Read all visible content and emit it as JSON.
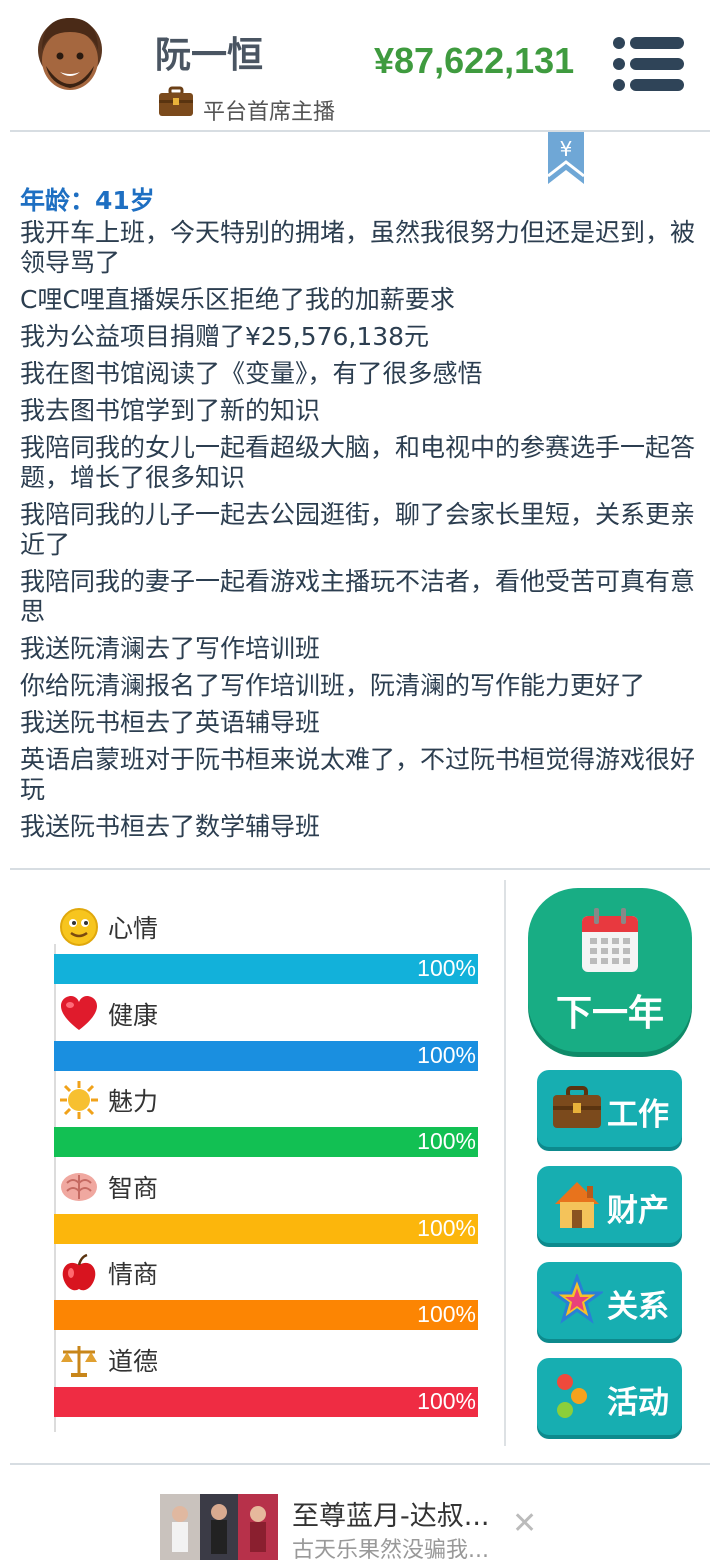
{
  "header": {
    "name": "阮一恒",
    "job_title": "平台首席主播",
    "money": "¥87,622,131"
  },
  "log": {
    "age": "年龄：41岁",
    "lines": [
      "我开车上班，今天特别的拥堵，虽然我很努力但还是迟到，被领导骂了",
      "C哩C哩直播娱乐区拒绝了我的加薪要求",
      "我为公益项目捐赠了¥25,576,138元",
      "我在图书馆阅读了《变量》，有了很多感悟",
      "我去图书馆学到了新的知识",
      "我陪同我的女儿一起看超级大脑，和电视中的参赛选手一起答题，增长了很多知识",
      "我陪同我的儿子一起去公园逛街，聊了会家长里短，关系更亲近了",
      "我陪同我的妻子一起看游戏主播玩不洁者，看他受苦可真有意思",
      "我送阮清澜去了写作培训班",
      "你给阮清澜报名了写作培训班，阮清澜的写作能力更好了",
      "我送阮书桓去了英语辅导班",
      "英语启蒙班对于阮书桓来说太难了，不过阮书桓觉得游戏很好玩",
      "我送阮书桓去了数学辅导班"
    ]
  },
  "stats": [
    {
      "label": "心情",
      "value_text": "100%",
      "level": 1.0,
      "color": "#12b1da",
      "icon": "smiley-icon"
    },
    {
      "label": "健康",
      "value_text": "100%",
      "level": 1.0,
      "color": "#1a8fe0",
      "icon": "heart-icon"
    },
    {
      "label": "魅力",
      "value_text": "100%",
      "level": 1.0,
      "color": "#12c053",
      "icon": "sun-icon"
    },
    {
      "label": "智商",
      "value_text": "100%",
      "level": 1.0,
      "color": "#fcb60c",
      "icon": "brain-icon"
    },
    {
      "label": "情商",
      "value_text": "100%",
      "level": 1.0,
      "color": "#fc8503",
      "icon": "apple-icon"
    },
    {
      "label": "道德",
      "value_text": "100%",
      "level": 1.0,
      "color": "#ef2c43",
      "icon": "scales-icon"
    }
  ],
  "actions": {
    "next_year": "下一年",
    "work": "工作",
    "property": "财产",
    "relations": "关系",
    "activities": "活动"
  },
  "ad": {
    "title": "至尊蓝月-达叔...",
    "subtitle": "古天乐果然没骗我...",
    "close": "✕"
  },
  "bookmark_symbol": "¥"
}
